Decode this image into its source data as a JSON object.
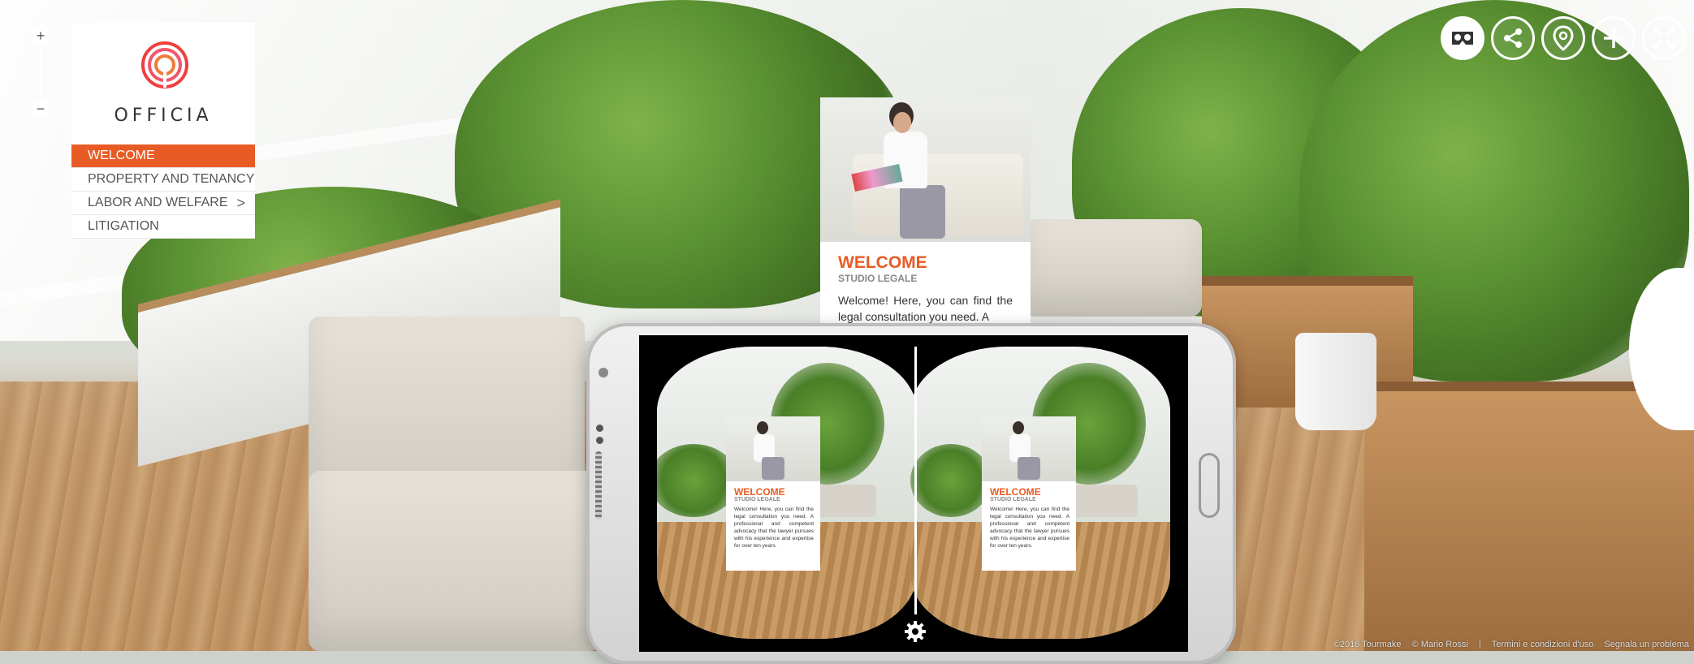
{
  "zoom": {
    "plus": "+",
    "minus": "−",
    "icons": [
      "zoom-in-icon",
      "zoom-out-icon"
    ]
  },
  "brand": {
    "name": "OFFICIA",
    "logo_icon": "spiral-logo-icon",
    "accent": "#e95b24"
  },
  "menu": {
    "items": [
      {
        "label": "WELCOME",
        "active": true
      },
      {
        "label": "PROPERTY AND TENANCY"
      },
      {
        "label": "LABOR AND WELFARE",
        "has_submenu": true
      },
      {
        "label": "LITIGATION"
      }
    ],
    "chevron": ">"
  },
  "toolbar": {
    "icons": [
      "vr-headset-icon",
      "share-icon",
      "map-pin-icon",
      "plus-circle-icon",
      "fullscreen-icon"
    ]
  },
  "card": {
    "title": "WELCOME",
    "subtitle": "STUDIO LEGALE",
    "body": "Welcome! Here, you can find the legal consultation you need. A"
  },
  "vr": {
    "card_title": "WELCOME",
    "card_subtitle": "STUDIO LEGALE",
    "card_body": "Welcome! Here, you can find the legal consultation you need. A professional and competent advocacy that the lawyer pursues with his experience and expertise for over ten years.",
    "settings_icon": "gear-icon"
  },
  "footer": {
    "copyright": "©2016 Tourmake",
    "author": "© Mario Rossi",
    "separator": "|",
    "terms": "Termini e condizioni d'uso",
    "report": "Segnala un problema"
  }
}
